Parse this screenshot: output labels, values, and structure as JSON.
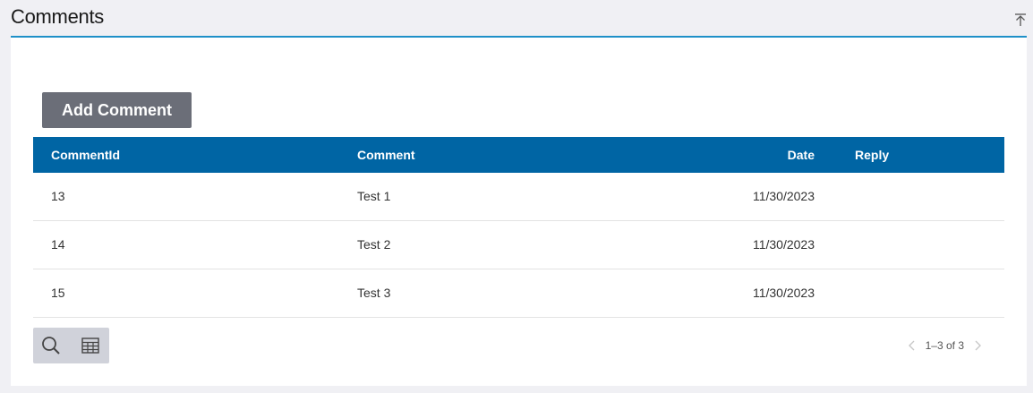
{
  "section": {
    "title": "Comments"
  },
  "actions": {
    "add_comment_label": "Add Comment"
  },
  "grid": {
    "columns": {
      "id": "CommentId",
      "comment": "Comment",
      "date": "Date",
      "reply": "Reply"
    },
    "rows": [
      {
        "id": "13",
        "comment": "Test 1",
        "date": "11/30/2023",
        "reply": ""
      },
      {
        "id": "14",
        "comment": "Test 2",
        "date": "11/30/2023",
        "reply": ""
      },
      {
        "id": "15",
        "comment": "Test 3",
        "date": "11/30/2023",
        "reply": ""
      }
    ]
  },
  "pager": {
    "range_text": "1–3 of 3"
  },
  "icons": {
    "collapse": "collapse-up-icon",
    "search": "search-icon",
    "table": "table-grid-icon",
    "prev": "chevron-left-icon",
    "next": "chevron-right-icon"
  },
  "colors": {
    "header_bg": "#0065a4",
    "button_bg": "#6b6e78",
    "accent_line": "#1e90c8"
  }
}
